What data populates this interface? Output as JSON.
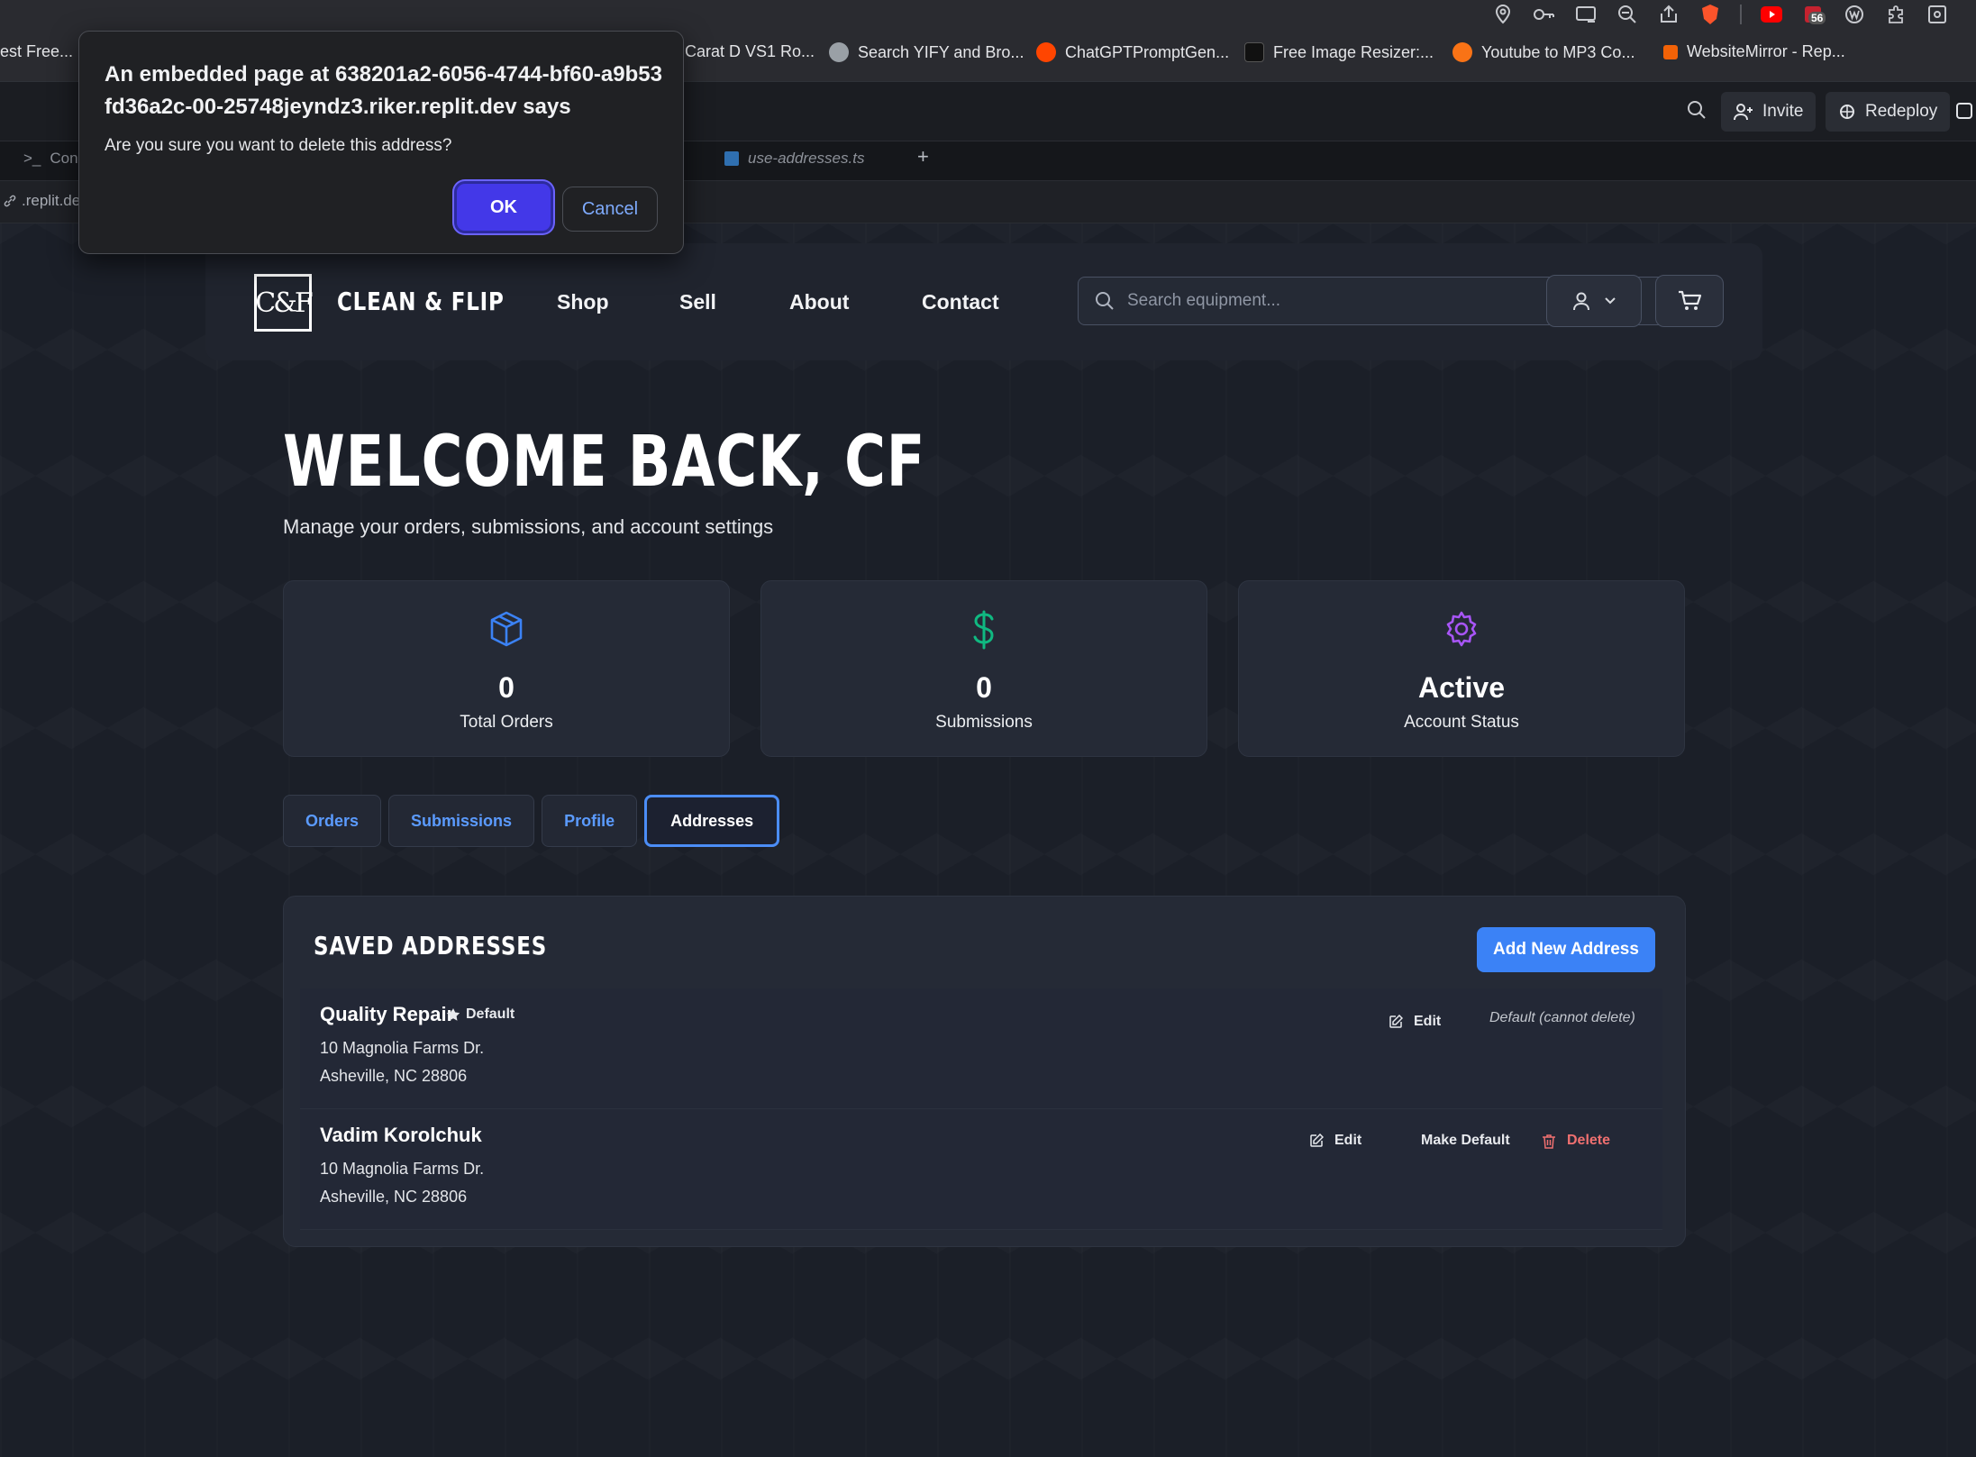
{
  "browser": {
    "bookmarks": [
      {
        "label": "est Free...",
        "color": "#3b82f6"
      },
      {
        "label": "Carat D VS1 Ro...",
        "color": ""
      },
      {
        "label": "Search YIFY and Bro...",
        "color": "#9aa0a6"
      },
      {
        "label": "ChatGPTPromptGen...",
        "color": "#ff4500"
      },
      {
        "label": "Free Image Resizer:...",
        "color": "#222222"
      },
      {
        "label": "Youtube to MP3 Co...",
        "color": "#f97316"
      },
      {
        "label": "WebsiteMirror - Rep...",
        "color": "#f26207"
      }
    ],
    "extension_badge": "56",
    "replit": {
      "invite_label": "Invite",
      "redeploy_label": "Redeploy",
      "tabs": [
        {
          "label": "Con"
        },
        {
          "label": "use-addresses.ts"
        },
        {
          "label": "+"
        }
      ],
      "url_fragment": ".replit.de"
    }
  },
  "dialog": {
    "title": "An embedded page at 638201a2-6056-4744-bf60-a9b53fd36a2c-00-25748jeyndz3.riker.replit.dev says",
    "message": "Are you sure you want to delete this address?",
    "ok_label": "OK",
    "cancel_label": "Cancel"
  },
  "site": {
    "logo_mark": "C&F",
    "logo_text": "CLEAN & FLIP",
    "nav": [
      "Shop",
      "Sell",
      "About",
      "Contact"
    ],
    "search_placeholder": "Search equipment...",
    "welcome": "WELCOME BACK, CF",
    "welcome_sub": "Manage your orders, submissions, and account settings",
    "stats": [
      {
        "value": "0",
        "label": "Total Orders",
        "icon": "package-icon",
        "color": "#3b82f6"
      },
      {
        "value": "0",
        "label": "Submissions",
        "icon": "dollar-icon",
        "color": "#10b981"
      },
      {
        "value": "Active",
        "label": "Account Status",
        "icon": "gear-icon",
        "color": "#a855f7"
      }
    ],
    "tabs": [
      "Orders",
      "Submissions",
      "Profile",
      "Addresses"
    ],
    "active_tab": "Addresses",
    "addresses_title": "SAVED ADDRESSES",
    "add_button": "Add New Address",
    "addresses": [
      {
        "name": "Quality Repair",
        "default_badge": "Default",
        "line1": "10 Magnolia Farms Dr.",
        "line2": "Asheville, NC 28806",
        "edit_label": "Edit",
        "note": "Default (cannot delete)"
      },
      {
        "name": "Vadim Korolchuk",
        "line1": "10 Magnolia Farms Dr.",
        "line2": "Asheville, NC 28806",
        "edit_label": "Edit",
        "make_default_label": "Make Default",
        "delete_label": "Delete"
      }
    ]
  }
}
